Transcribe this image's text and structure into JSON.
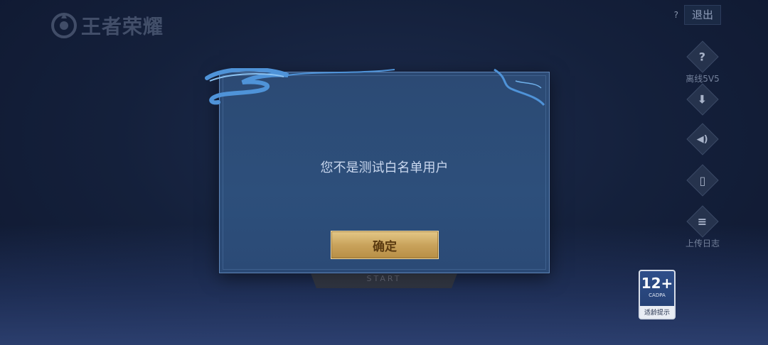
{
  "header": {
    "logo_text": "王者荣耀",
    "help_mark": "?",
    "exit_label": "退出"
  },
  "side_buttons": [
    {
      "icon": "question-icon",
      "glyph": "?",
      "label": "离线5V5"
    },
    {
      "icon": "download-icon",
      "glyph": "⬇",
      "label": ""
    },
    {
      "icon": "sound-icon",
      "glyph": "🔊",
      "label": ""
    },
    {
      "icon": "phone-icon",
      "glyph": "▯",
      "label": ""
    },
    {
      "icon": "log-icon",
      "glyph": "≡",
      "label": "上传日志"
    }
  ],
  "start": {
    "label": "START"
  },
  "dialog": {
    "message": "您不是测试白名单用户",
    "confirm_label": "确定"
  },
  "age_badge": {
    "age": "12+",
    "org": "CADPA",
    "tip": "适龄提示"
  },
  "colors": {
    "background": "#14203b",
    "dialog": "#2c4a74",
    "confirm_button": "#c9a35c",
    "message_text": "#c9d7ee"
  }
}
